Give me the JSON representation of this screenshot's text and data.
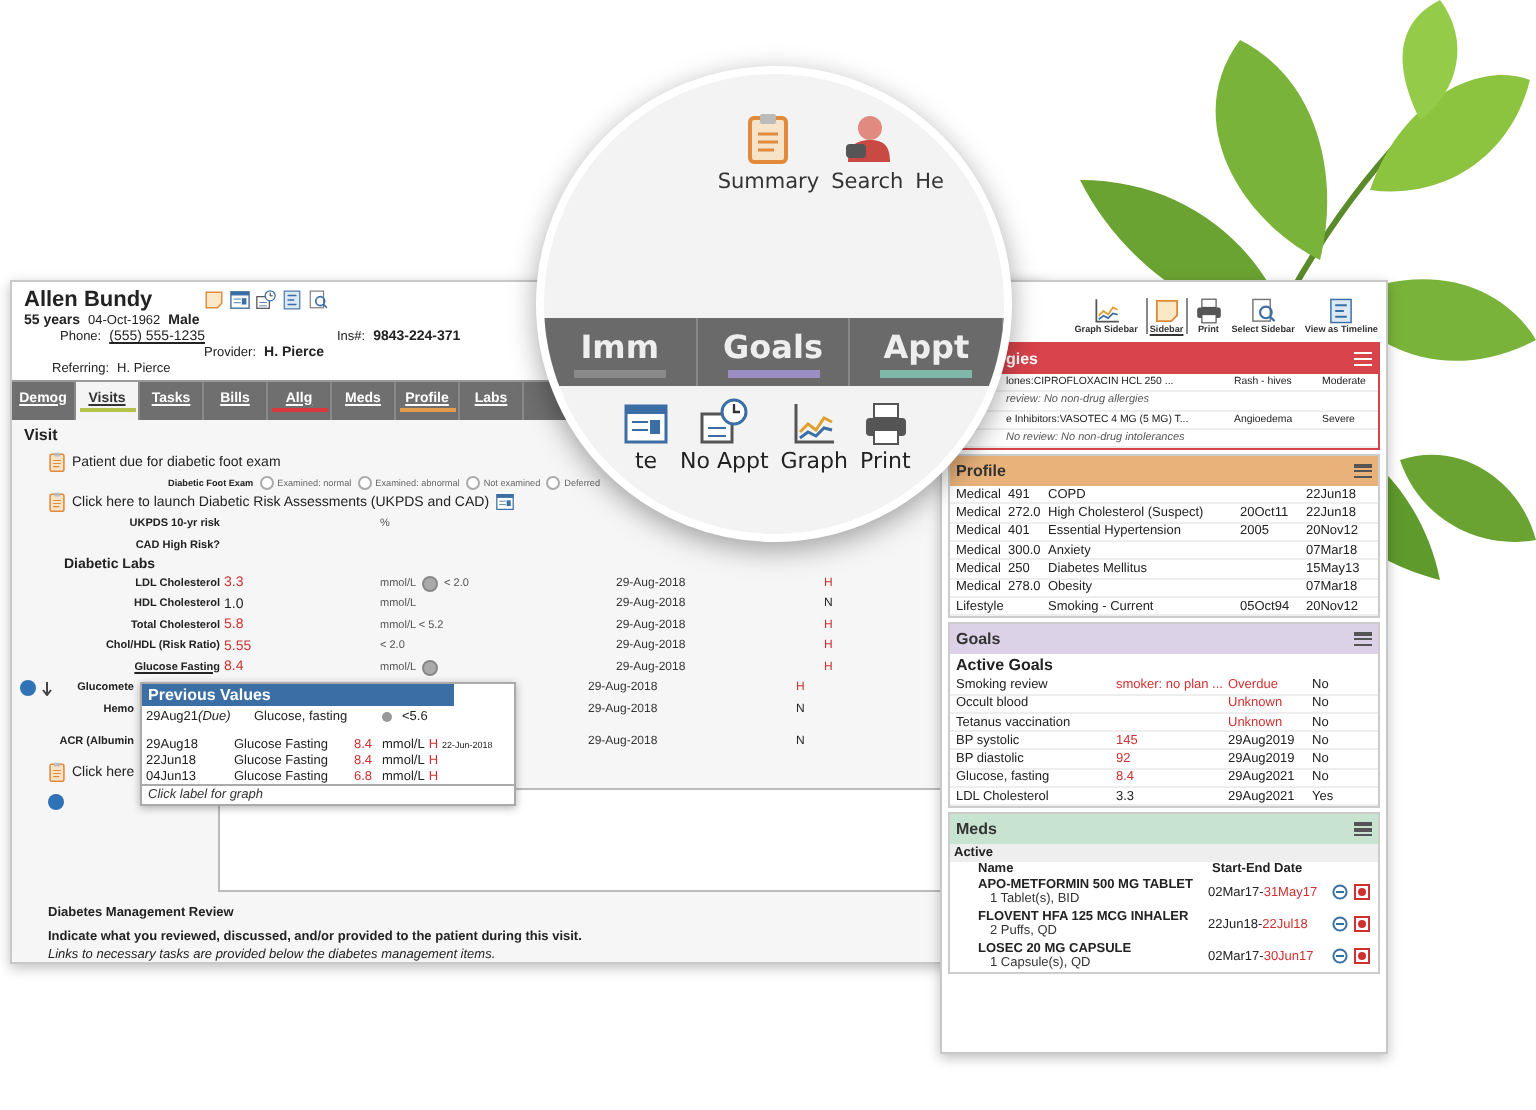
{
  "patient": {
    "name": "Allen Bundy",
    "age": "55 years",
    "dob": "04-Oct-1962",
    "sex": "Male",
    "phone_label": "Phone:",
    "phone": "(555) 555-1235",
    "provider_label": "Provider:",
    "provider": "H. Pierce",
    "ins_label": "Ins#:",
    "ins": "9843-224-371",
    "referring_label": "Referring:",
    "referring": "H. Pierce"
  },
  "tabs": [
    {
      "label": "Demog",
      "selected": false
    },
    {
      "label": "Visits",
      "selected": true,
      "color": "#b5c24a"
    },
    {
      "label": "Tasks",
      "selected": false
    },
    {
      "label": "Bills",
      "selected": false
    },
    {
      "label": "Allg",
      "selected": false,
      "color": "#d9363e"
    },
    {
      "label": "Meds",
      "selected": false
    },
    {
      "label": "Profile",
      "selected": false,
      "color": "#e39a4a"
    },
    {
      "label": "Labs",
      "selected": false
    }
  ],
  "visit": {
    "title": "Visit",
    "foot_notice": "Patient due for diabetic foot exam",
    "foot_exam": {
      "label": "Diabetic Foot Exam",
      "options": [
        {
          "label": "Examined: normal",
          "selected": false
        },
        {
          "label": "Examined: abnormal",
          "selected": false
        },
        {
          "label": "Not examined",
          "selected": false
        },
        {
          "label": "Deferred",
          "selected": false
        }
      ]
    },
    "risk_link": "Click here to launch Diabetic Risk Assessments (UKPDS and CAD)",
    "risk_rows": [
      {
        "label": "UKPDS 10-yr risk",
        "unit": "%"
      },
      {
        "label": "CAD High Risk?"
      }
    ],
    "labs_title": "Diabetic Labs",
    "labs": [
      {
        "label": "LDL Cholesterol",
        "value": "3.3",
        "high": true,
        "unit": "mmol/L",
        "chart_icon": true,
        "ref": "< 2.0",
        "date": "29-Aug-2018",
        "flag": "H",
        "link": false
      },
      {
        "label": "HDL Cholesterol",
        "value": "1.0",
        "high": false,
        "unit": "mmol/L",
        "chart_icon": false,
        "date": "29-Aug-2018",
        "flag": "N",
        "link": false
      },
      {
        "label": "Total Cholesterol",
        "value": "5.8",
        "high": true,
        "unit": "mmol/L < 5.2",
        "chart_icon": false,
        "date": "29-Aug-2018",
        "flag": "H",
        "link": false
      },
      {
        "label": "Chol/HDL (Risk Ratio)",
        "value": "5.55",
        "high": true,
        "unit": "< 2.0",
        "chart_icon": false,
        "date": "29-Aug-2018",
        "flag": "H",
        "link": false
      },
      {
        "label": "Glucose Fasting",
        "value": "8.4",
        "high": true,
        "unit": "mmol/L",
        "chart_icon": true,
        "date": "29-Aug-2018",
        "flag": "H",
        "link": true
      }
    ],
    "partial_labs": [
      {
        "label": "Glucomete",
        "date": "29-Aug-2018",
        "flag": "H",
        "high": true
      },
      {
        "label": "Hemo",
        "date": "29-Aug-2018",
        "flag": "N",
        "high": false
      },
      {
        "label": "ACR (Albumin",
        "date": "29-Aug-2018",
        "flag": "N",
        "high": false
      }
    ],
    "click_partial": "Click here",
    "review_title": "Diabetes Management Review",
    "review_text": "Indicate what you reviewed, discussed, and/or provided to the patient during this visit.",
    "review_note": "Links to necessary tasks are provided below the diabetes management items."
  },
  "popup": {
    "title": "Previous Values",
    "due": {
      "date": "29Aug21",
      "status": "(Due)",
      "test": "Glucose, fasting",
      "target": "<5.6"
    },
    "rows": [
      {
        "date": "29Aug18",
        "test": "Glucose Fasting",
        "value": "8.4",
        "unit": "mmol/L",
        "flag": "H",
        "note": "22-Jun-2018"
      },
      {
        "date": "22Jun18",
        "test": "Glucose Fasting",
        "value": "8.4",
        "unit": "mmol/L",
        "flag": "H"
      },
      {
        "date": "04Jun13",
        "test": "Glucose Fasting",
        "value": "6.8",
        "unit": "mmol/L",
        "flag": "H"
      }
    ],
    "footer": "Click label for graph"
  },
  "lens": {
    "toolbar": [
      {
        "label": "Summary",
        "kind": "clipboard"
      },
      {
        "label": "Search",
        "kind": "person"
      },
      {
        "label": "He",
        "kind": "none"
      }
    ],
    "tabs": [
      {
        "label": "Imm",
        "color": "#8a8a8a"
      },
      {
        "label": "Goals",
        "color": "#9b8ec4"
      },
      {
        "label": "Appt",
        "color": "#7fb8a8"
      }
    ],
    "actions": [
      {
        "label": "te",
        "kind": "form"
      },
      {
        "label": "No Appt",
        "kind": "calendar"
      },
      {
        "label": "Graph",
        "kind": "graph"
      },
      {
        "label": "Print",
        "kind": "print"
      }
    ]
  },
  "sidebar": {
    "toolbar": [
      {
        "label": "Graph Sidebar",
        "kind": "graph",
        "selected": false
      },
      {
        "label": "Sidebar",
        "kind": "note",
        "selected": true
      },
      {
        "label": "Print",
        "kind": "print",
        "selected": false
      },
      {
        "label": "Select Sidebar",
        "kind": "select",
        "selected": false
      },
      {
        "label": "View as Timeline",
        "kind": "timeline",
        "selected": false
      }
    ],
    "allergies": {
      "title": "gies",
      "color": "#d9434b",
      "rows": [
        {
          "kind": "item",
          "text": "lones:CIPROFLOXACIN HCL 250 ...",
          "reaction": "Rash - hives",
          "severity": "Moderate"
        },
        {
          "kind": "note",
          "text": "review: No non-drug allergies"
        },
        {
          "kind": "item",
          "text": "e Inhibitors:VASOTEC 4 MG (5 MG) T...",
          "reaction": "Angioedema",
          "severity": "Severe"
        },
        {
          "kind": "note",
          "text": "No review: No non-drug intolerances"
        }
      ]
    },
    "profile": {
      "title": "Profile",
      "color": "#e8b27a",
      "rows": [
        {
          "type": "Medical",
          "code": "491",
          "desc": "COPD",
          "date2": "22Jun18"
        },
        {
          "type": "Medical",
          "code": "272.0",
          "desc": "High Cholesterol (Suspect)",
          "date1": "20Oct11",
          "date2": "22Jun18"
        },
        {
          "type": "Medical",
          "code": "401",
          "desc": "Essential Hypertension",
          "date1": "2005",
          "date2": "20Nov12"
        },
        {
          "type": "Medical",
          "code": "300.0",
          "desc": "Anxiety",
          "date2": "07Mar18"
        },
        {
          "type": "Medical",
          "code": "250",
          "desc": "Diabetes Mellitus",
          "date2": "15May13"
        },
        {
          "type": "Medical",
          "code": "278.0",
          "desc": "Obesity",
          "date2": "07Mar18"
        },
        {
          "type": "Lifestyle",
          "desc": "Smoking - Current",
          "date1": "05Oct94",
          "date2": "20Nov12"
        }
      ]
    },
    "goals": {
      "title": "Goals",
      "color": "#dcd2e8",
      "subtitle": "Active Goals",
      "rows": [
        {
          "name": "Smoking review",
          "value": "smoker: no plan ...",
          "value_alert": true,
          "status": "Overdue",
          "status_alert": true,
          "met": "No"
        },
        {
          "name": "Occult blood",
          "status": "Unknown",
          "status_alert": true,
          "met": "No"
        },
        {
          "name": "Tetanus vaccination",
          "status": "Unknown",
          "status_alert": true,
          "met": "No"
        },
        {
          "name": "BP systolic",
          "value": "145",
          "value_alert": true,
          "status": "29Aug2019",
          "status_alert": false,
          "met": "No"
        },
        {
          "name": "BP diastolic",
          "value": "92",
          "value_alert": true,
          "status": "29Aug2019",
          "status_alert": false,
          "met": "No"
        },
        {
          "name": "Glucose, fasting",
          "value": "8.4",
          "value_alert": true,
          "status": "29Aug2021",
          "status_alert": false,
          "met": "No"
        },
        {
          "name": "LDL Cholesterol",
          "value": "3.3",
          "value_alert": false,
          "status": "29Aug2021",
          "status_alert": false,
          "met": "Yes"
        }
      ]
    },
    "meds": {
      "title": "Meds",
      "color": "#c8e3cf",
      "group": "Active",
      "columns": [
        "Name",
        "Start-End Date"
      ],
      "rows": [
        {
          "name": "APO-METFORMIN 500 MG TABLET",
          "sig": "1 Tablet(s), BID",
          "start": "02Mar17-",
          "end": "31May17"
        },
        {
          "name": "FLOVENT HFA 125 MCG INHALER",
          "sig": "2 Puffs, QD",
          "start": "22Jun18-",
          "end": "22Jul18"
        },
        {
          "name": "LOSEC 20 MG CAPSULE",
          "sig": "1 Capsule(s), QD",
          "start": "02Mar17-",
          "end": "30Jun17"
        }
      ]
    }
  }
}
